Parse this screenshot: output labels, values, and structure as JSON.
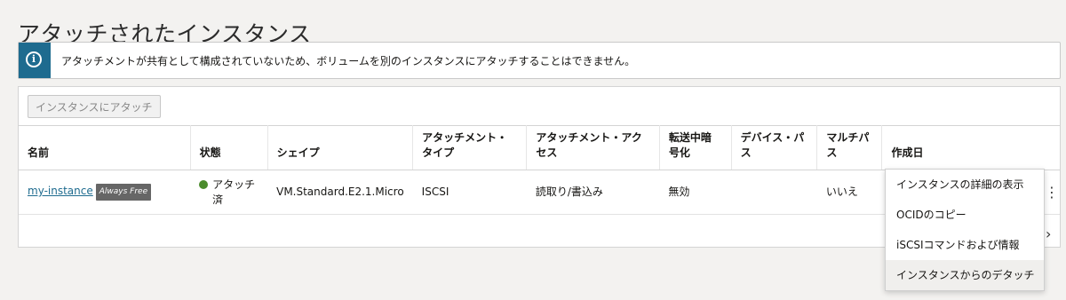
{
  "page": {
    "title": "アタッチされたインスタンス"
  },
  "banner": {
    "icon": "info-icon",
    "icon_glyph": "i",
    "text": "アタッチメントが共有として構成されていないため、ボリュームを別のインスタンスにアタッチすることはできません。"
  },
  "toolbar": {
    "attach_label": "インスタンスにアタッチ"
  },
  "table": {
    "headers": [
      "名前",
      "状態",
      "シェイプ",
      "アタッチメント・タイプ",
      "アタッチメント・アクセス",
      "転送中暗号化",
      "デバイス・パス",
      "マルチパス",
      "作成日"
    ],
    "rows": [
      {
        "name": "my-instance",
        "badge": "Always Free",
        "status": "アタッチ済",
        "status_color": "#4a8b2c",
        "shape": "VM.Standard.E2.1.Micro",
        "attachment_type": "ISCSI",
        "access": "読取り/書込み",
        "encryption": "無効",
        "device_path": "",
        "multipath": "いいえ",
        "created": ""
      }
    ]
  },
  "actions_menu": {
    "kebab_glyph": "⋮",
    "items": [
      "インスタンスの詳細の表示",
      "OCIDのコピー",
      "iSCSIコマンドおよび情報",
      "インスタンスからのデタッチ"
    ]
  },
  "scroll_chevron": "›",
  "colors": {
    "banner_accent": "#1e6b8f",
    "link": "#1e6b8f",
    "badge_bg": "#666666"
  }
}
